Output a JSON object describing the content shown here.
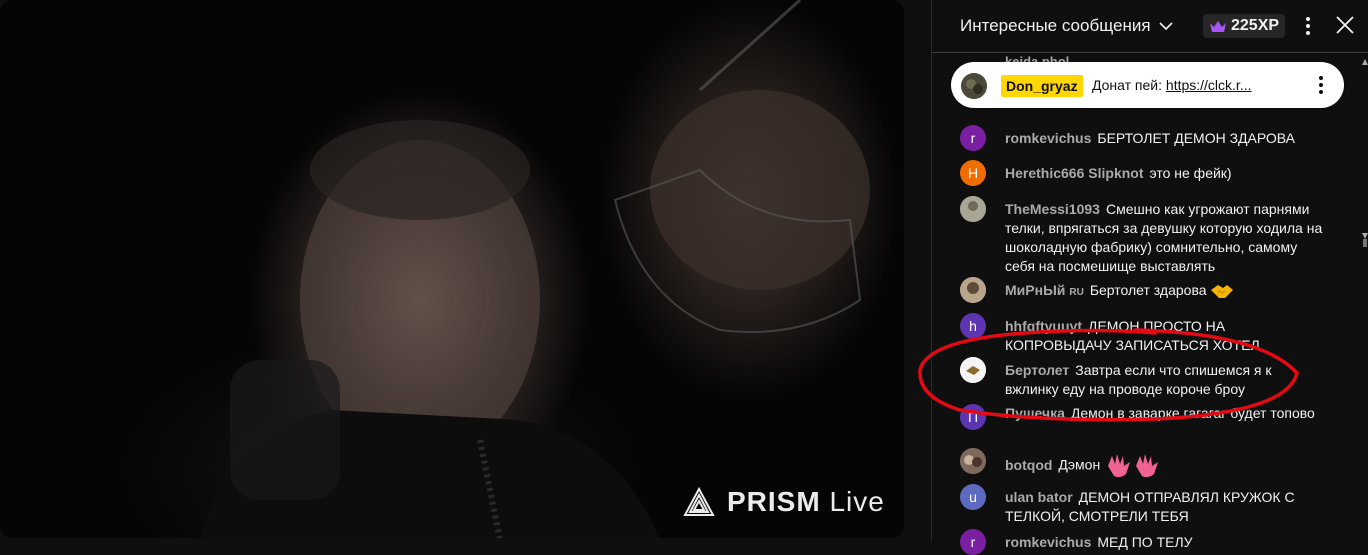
{
  "video": {
    "watermark_brand": "PRISM",
    "watermark_suffix": "Live"
  },
  "chat": {
    "header_title": "Интересные сообщения",
    "xp_label": "225XP",
    "pinned": {
      "author": "Don_gryaz",
      "text_prefix": "Донат пей: ",
      "link_text": "https://clck.r..."
    },
    "partial_top_author": "keida.phol",
    "messages": [
      {
        "author": "romkevichus",
        "text": "БЕРТОЛЕТ ДЕМОН ЗДАРОВА",
        "avatar_letter": "r",
        "avatar_color": "#7b1fa2"
      },
      {
        "author": "Herethic666 Slipknot",
        "text": "это не фейк)",
        "avatar_letter": "H",
        "avatar_color": "#ef6c00"
      },
      {
        "author": "TheMessi1093",
        "text": "Смешно как угрожают парнями телки, впрягаться за девушку которую ходила на шоколадную фабрику) сомнительно, самому себя на посмешище выставлять",
        "avatar_letter": "",
        "avatar_color": "#8d8a7e"
      },
      {
        "author": "МиРнЫй",
        "flag": "RU",
        "text": "Бертолет здарова",
        "avatar_letter": "",
        "avatar_color": "#8a7a6a",
        "emoji": "handshake-emoji"
      },
      {
        "author": "hhfgftyuuyt",
        "text": "ДЕМОН ПРОСТО НА КОПРОВЫДАЧУ ЗАПИСАТЬСЯ ХОТЕЛ",
        "avatar_letter": "h",
        "avatar_color": "#5e35b1"
      },
      {
        "author": "Бертолет",
        "text": "Завтра если что спишемся я к вжлинку еду на проводе короче броу",
        "avatar_letter": "",
        "avatar_color": "#f1f1f1"
      },
      {
        "author": "Пушечка",
        "text": "Демон в заварке гагагаг будет топово",
        "avatar_letter": "П",
        "avatar_color": "#5e35b1"
      },
      {
        "author": "botqod",
        "text": "Дэмон",
        "avatar_letter": "",
        "avatar_color": "#6d4c41",
        "emoji": "waving-hand-emoji"
      },
      {
        "author": "ulan bator",
        "text": "ДЕМОН ОТПРАВЛЯЛ КРУЖОК С ТЕЛКОЙ, СМОТРЕЛИ ТЕБЯ",
        "avatar_letter": "u",
        "avatar_color": "#5c6bc0"
      },
      {
        "author": "romkevichus",
        "text": "МЕД ПО ТЕЛУ",
        "avatar_letter": "r",
        "avatar_color": "#7b1fa2"
      }
    ]
  },
  "colors": {
    "pinned_author_bg": "#ffd600",
    "annotation_circle": "#e50914",
    "xp_crown": "#a855f7"
  }
}
